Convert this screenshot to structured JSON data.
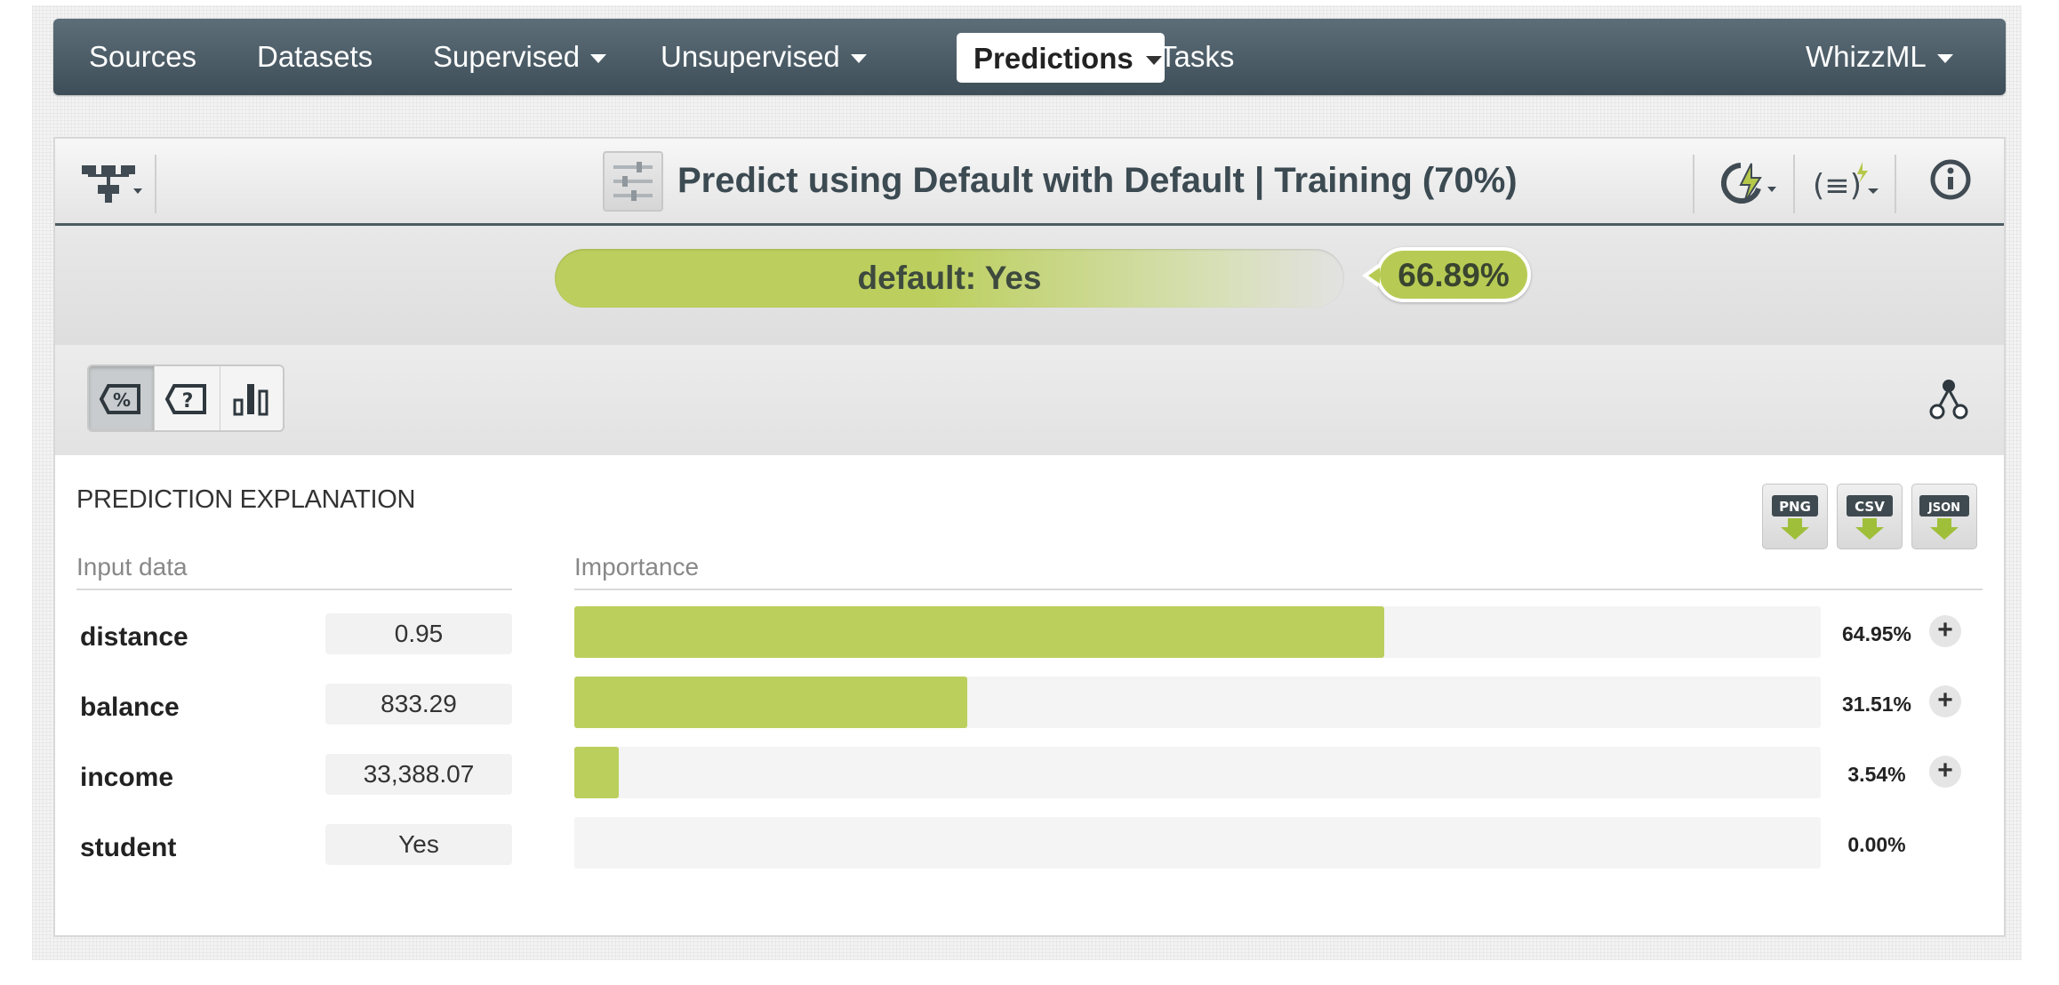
{
  "nav": {
    "items": [
      {
        "label": "Sources",
        "dropdown": false
      },
      {
        "label": "Datasets",
        "dropdown": false
      },
      {
        "label": "Supervised",
        "dropdown": true
      },
      {
        "label": "Unsupervised",
        "dropdown": true
      },
      {
        "label": "Predictions",
        "dropdown": true,
        "active": true
      },
      {
        "label": "Tasks",
        "dropdown": false
      }
    ],
    "user_menu": "WhizzML"
  },
  "header": {
    "title": "Predict using Default with Default | Training (70%)",
    "icons": [
      "tree-dropdown-icon",
      "prediction-icon",
      "batch-predict-icon",
      "script-dropdown-icon",
      "info-icon"
    ]
  },
  "prediction": {
    "label": "default: Yes",
    "confidence_text": "66.89%",
    "confidence": 66.89
  },
  "view_toggle": {
    "options": [
      "percent-view-icon",
      "question-view-icon",
      "bar-chart-view-icon"
    ],
    "active": "percent-view-icon"
  },
  "explanation": {
    "title": "PREDICTION EXPLANATION",
    "export_buttons": [
      "PNG",
      "CSV",
      "JSON"
    ],
    "input_header": "Input data",
    "importance_header": "Importance",
    "rows": [
      {
        "field": "distance",
        "value": "0.95",
        "importance": 64.95,
        "importance_label": "64.95%",
        "expandable": true
      },
      {
        "field": "balance",
        "value": "833.29",
        "importance": 31.51,
        "importance_label": "31.51%",
        "expandable": true
      },
      {
        "field": "income",
        "value": "33,388.07",
        "importance": 3.54,
        "importance_label": "3.54%",
        "expandable": true
      },
      {
        "field": "student",
        "value": "Yes",
        "importance": 0.0,
        "importance_label": "0.00%",
        "expandable": false
      }
    ]
  },
  "colors": {
    "nav_bg": "#4a5a64",
    "accent_green": "#bbcf5d",
    "header_border": "#4d5a62"
  }
}
